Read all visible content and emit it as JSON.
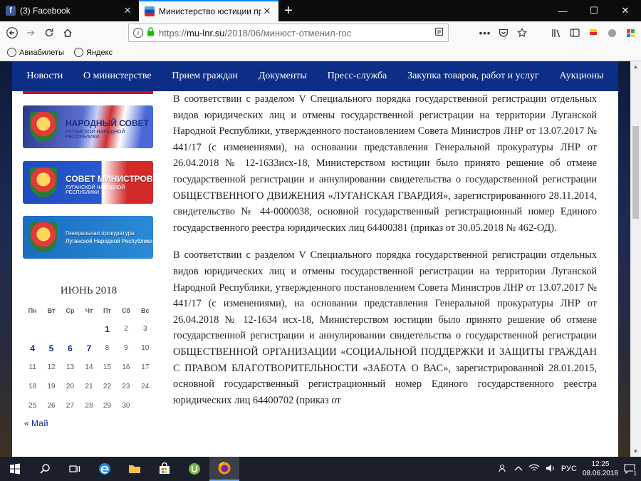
{
  "browser": {
    "tabs": [
      {
        "title": "(3) Facebook",
        "close": "✕"
      },
      {
        "title": "Министерство юстиции прин",
        "close": "✕"
      }
    ],
    "new_tab": "+",
    "window_controls": [
      "—",
      "☐",
      "✕"
    ],
    "url": {
      "scheme": "https://",
      "host": "mu-lnr.su",
      "path": "/2018/06/минюст-отменил-гос"
    },
    "bookmarks": [
      "Авиабилеты",
      "Яндекс"
    ]
  },
  "site": {
    "menu": [
      "Новости",
      "О министерстве",
      "Прием граждан",
      "Документы",
      "Пресс-служба",
      "Закупка товаров, работ и услуг",
      "Аукционы"
    ],
    "banners": [
      {
        "title": "НАРОДНЫЙ СОВЕТ",
        "subtitle": "ЛУГАНСКОЙ НАРОДНОЙ РЕСПУБЛИКИ"
      },
      {
        "title": "СОВЕТ МИНИСТРОВ",
        "subtitle": "ЛУГАНСКОЙ НАРОДНОЙ РЕСПУБЛИКИ"
      },
      {
        "title": "Генеральная прокуратура",
        "subtitle": "Луганской Народной Республики"
      }
    ],
    "calendar": {
      "month": "ИЮНЬ 2018",
      "weekdays": [
        "Пн",
        "Вт",
        "Ср",
        "Чт",
        "Пт",
        "Сб",
        "Вс"
      ],
      "weeks": [
        [
          "",
          "",
          "",
          "",
          "1",
          "2",
          "3"
        ],
        [
          "4",
          "5",
          "6",
          "7",
          "8",
          "9",
          "10"
        ],
        [
          "11",
          "12",
          "13",
          "14",
          "15",
          "16",
          "17"
        ],
        [
          "18",
          "19",
          "20",
          "21",
          "22",
          "23",
          "24"
        ],
        [
          "25",
          "26",
          "27",
          "28",
          "29",
          "30",
          ""
        ]
      ],
      "linked_days": [
        "1",
        "4",
        "5",
        "6",
        "7"
      ],
      "prev": "« Май"
    },
    "article": [
      "В соответствии с разделом V Специального порядка государственной регистрации отдельных видов юридических лиц и отмены государственной регистрации на территории Луганской Народной Республики, утвержденного постановлением Совета Министров ЛНР от 13.07.2017 № 441/17 (с изменениями), на основании представления Генеральной прокуратуры ЛНР от 26.04.2018 № 12-1633исх-18, Министерством юстиции было принято решение об отмене государственной регистрации и аннулировании свидетельства о государственной регистрации ОБЩЕСТВЕННОГО ДВИЖЕНИЯ «ЛУГАНСКАЯ ГВАРДИЯ», зарегистрированного 28.11.2014, свидетельство № 44-0000038, основной государственный регистрационный номер Единого государственного реестра юридических лиц 64400381 (приказ от 30.05.2018 № 462-ОД).",
      "В соответствии с разделом V Специального порядка государственной регистрации отдельных видов юридических лиц и отмены государственной регистрации на территории Луганской Народной Республики, утвержденного постановлением Совета Министров ЛНР от 13.07.2017 № 441/17 (с изменениями), на основании представления Генеральной прокуратуры ЛНР от 26.04.2018 № 12-1634 исх-18, Министерством юстиции было принято решение об отмене государственной регистрации и аннулировании свидетельства о государственной регистрации ОБЩЕСТВЕННОЙ ОРГАНИЗАЦИИ «СОЦИАЛЬНОЙ ПОДДЕРЖКИ И ЗАЩИТЫ ГРАЖДАН С ПРАВОМ БЛАГОТВОРИТЕЛЬНОСТИ «ЗАБОТА О ВАС», зарегистрированной 28.01.2015, основной государственный регистрационный номер Единого государственного реестра юридических лиц 64400702 (приказ от"
    ]
  },
  "taskbar": {
    "lang": "РУС",
    "time": "12:25",
    "date": "08.06.2018",
    "notifications": "1"
  },
  "colors": {
    "menu_bg": "#0d2e86",
    "tab_accent": "#0a84ff",
    "taskbar": "#1b1f2b"
  }
}
